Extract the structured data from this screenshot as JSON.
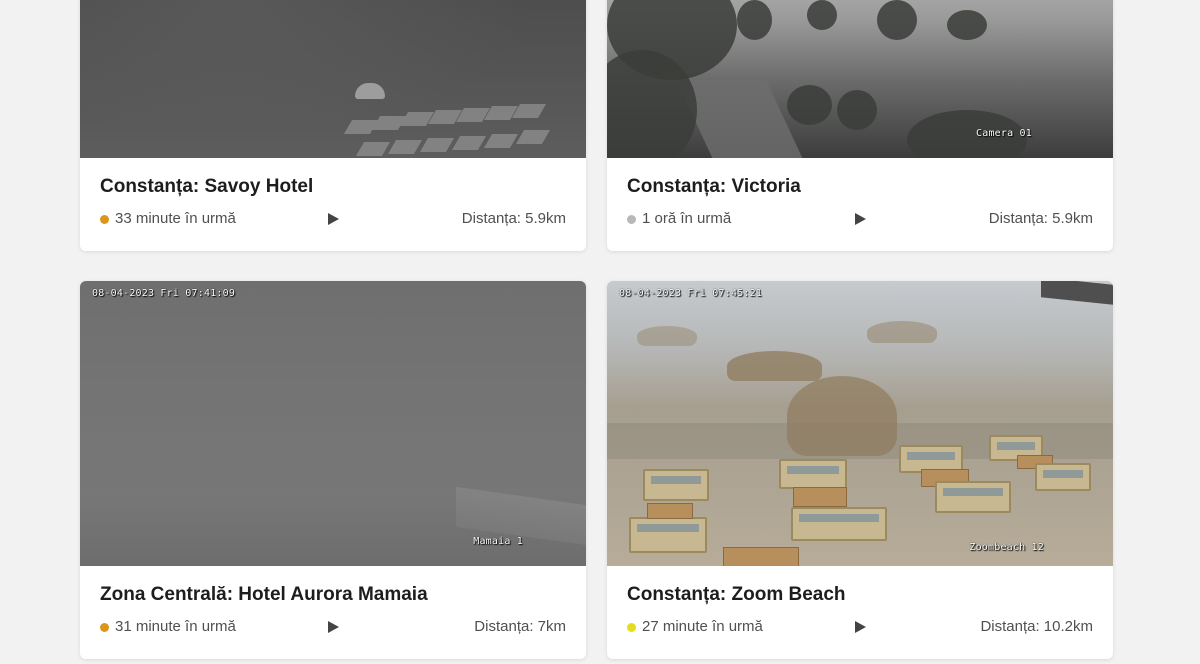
{
  "cameras": [
    {
      "title": "Constanța: Savoy Hotel",
      "time_ago": "33 minute în urmă",
      "status_color": "#d9961a",
      "distance": "Distanța: 5.9km",
      "timestamp": "",
      "camera_label": ""
    },
    {
      "title": "Constanța: Victoria",
      "time_ago": "1 oră în urmă",
      "status_color": "#b8b8b8",
      "distance": "Distanța: 5.9km",
      "timestamp": "",
      "camera_label": "Camera 01"
    },
    {
      "title": "Zona Centrală: Hotel Aurora Mamaia",
      "time_ago": "31 minute în urmă",
      "status_color": "#d9961a",
      "distance": "Distanța: 7km",
      "timestamp": "08-04-2023 Fri 07:41:09",
      "camera_label": "Mamaia 1"
    },
    {
      "title": "Constanța: Zoom Beach",
      "time_ago": "27 minute în urmă",
      "status_color": "#e6dc1e",
      "distance": "Distanța: 10.2km",
      "timestamp": "08-04-2023 Fri 07:45:21",
      "camera_label": "Zoombeach 12"
    }
  ],
  "icons": {
    "status": "status-dot-icon",
    "play": "play-icon"
  }
}
